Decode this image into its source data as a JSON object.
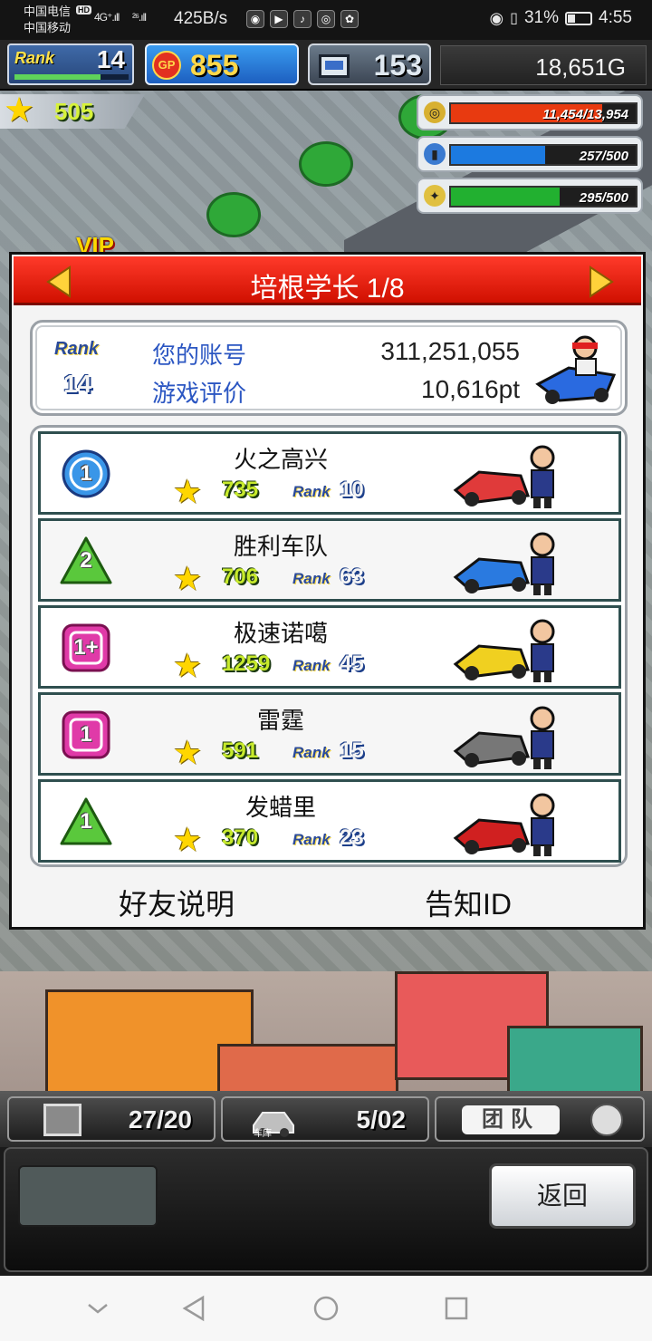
{
  "status_bar": {
    "carrier_1": "中国电信",
    "carrier_2": "中国移动",
    "hd": "HD",
    "signal_1": "4G⁺.ıll",
    "signal_2": "²⁶.ıll",
    "net_speed": "425B/s",
    "battery": "31%",
    "time": "4:55"
  },
  "hud_top": {
    "rank_label": "Rank",
    "rank_value": "14",
    "rank_progress": 0.75,
    "gp_icon": "GP",
    "gp_value": "855",
    "pc_value": "153",
    "money": "18,651G"
  },
  "stars": "505",
  "vip": "VIP",
  "resources": [
    {
      "icon": "coin-stack-icon",
      "text": "11,454/13,954",
      "fraction": 0.82,
      "color": "#e83a10"
    },
    {
      "icon": "water-bottle-icon",
      "text": "257/500",
      "fraction": 0.51,
      "color": "#1c7ae0"
    },
    {
      "icon": "wheat-icon",
      "text": "295/500",
      "fraction": 0.59,
      "color": "#22b030"
    }
  ],
  "dialog": {
    "title": "培根学长 1/8",
    "account": {
      "rank_label": "Rank",
      "rank_value": "14",
      "account_label": "您的账号",
      "account_value": "311,251,055",
      "rating_label": "游戏评价",
      "rating_value": "10,616pt"
    },
    "friends": [
      {
        "badge": "1",
        "badge_shape": "circle",
        "badge_color": "#3a96e8",
        "name": "火之高兴",
        "points": "735",
        "rank_label": "Rank",
        "rank": "10"
      },
      {
        "badge": "2",
        "badge_shape": "triangle",
        "badge_color": "#5ac83c",
        "name": "胜利车队",
        "points": "706",
        "rank_label": "Rank",
        "rank": "63"
      },
      {
        "badge": "1+",
        "badge_shape": "square",
        "badge_color": "#e03aa8",
        "name": "极速诺噶",
        "points": "1259",
        "rank_label": "Rank",
        "rank": "45"
      },
      {
        "badge": "1",
        "badge_shape": "square",
        "badge_color": "#e03aa8",
        "name": "雷霆",
        "points": "591",
        "rank_label": "Rank",
        "rank": "15"
      },
      {
        "badge": "1",
        "badge_shape": "triangle",
        "badge_color": "#5ac83c",
        "name": "发蜡里",
        "points": "370",
        "rank_label": "Rank",
        "rank": "23"
      }
    ],
    "friends_help": "好友说明",
    "notify_id": "告知ID"
  },
  "hud_bottom": {
    "tab1_text": "27/20",
    "tab2_caption": "车库",
    "tab2_text": "5/02",
    "tab3_text": "团队",
    "back_label": "返回"
  }
}
